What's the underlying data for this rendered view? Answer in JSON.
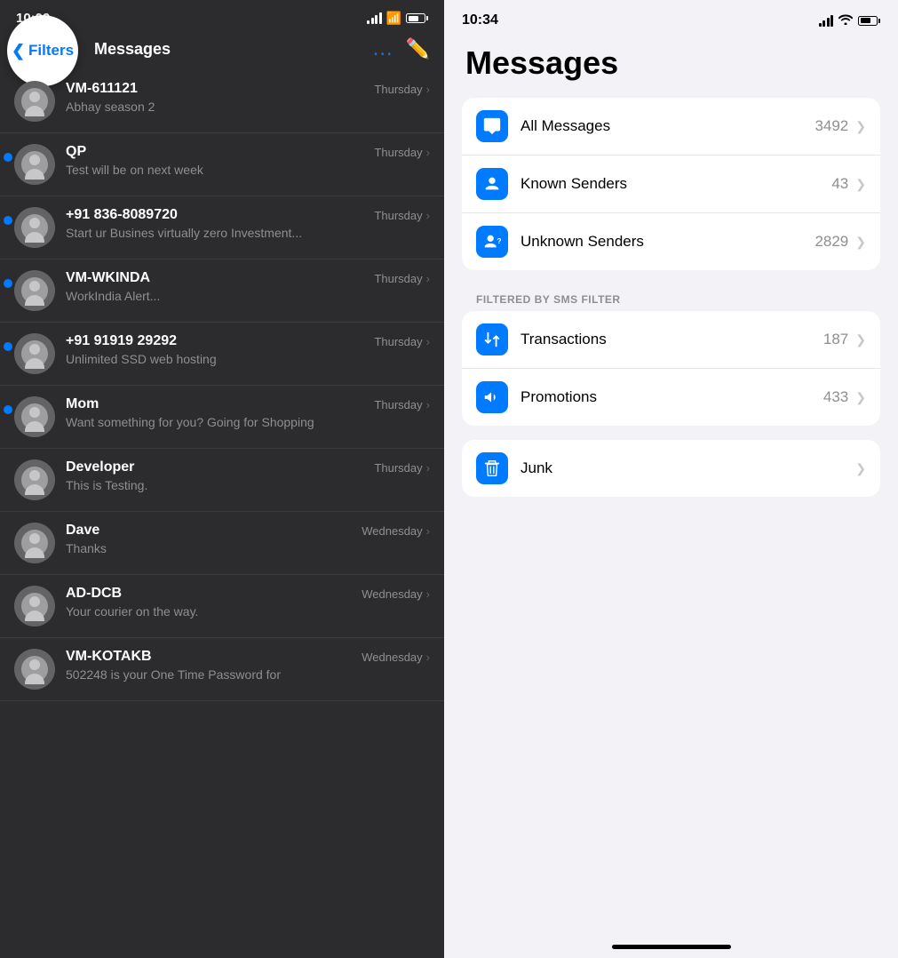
{
  "left": {
    "status_time": "10:09",
    "nav_title": "Messages",
    "filters_btn": "Filters",
    "messages": [
      {
        "id": "vm-611121",
        "name": "VM-611121",
        "date": "Thursday",
        "preview": "Abhay season 2",
        "unread": false
      },
      {
        "id": "qp",
        "name": "QP",
        "date": "Thursday",
        "preview": "Test will be on next week",
        "unread": true
      },
      {
        "id": "phone1",
        "name": "+91 836-8089720",
        "date": "Thursday",
        "preview": "Start ur Busines virtually zero Investment...",
        "unread": true
      },
      {
        "id": "vm-wkinda",
        "name": "VM-WKINDA",
        "date": "Thursday",
        "preview": "WorkIndia Alert...",
        "unread": true
      },
      {
        "id": "phone2",
        "name": "+91 91919 29292",
        "date": "Thursday",
        "preview": "Unlimited SSD web hosting",
        "unread": true
      },
      {
        "id": "mom",
        "name": "Mom",
        "date": "Thursday",
        "preview": "Want something for you? Going for Shopping",
        "unread": true
      },
      {
        "id": "developer",
        "name": "Developer",
        "date": "Thursday",
        "preview": "This is Testing.",
        "unread": false
      },
      {
        "id": "dave",
        "name": "Dave",
        "date": "Wednesday",
        "preview": "Thanks",
        "unread": false
      },
      {
        "id": "ad-dcb",
        "name": "AD-DCB",
        "date": "Wednesday",
        "preview": "Your courier on the way.",
        "unread": false
      },
      {
        "id": "vm-kotakb",
        "name": "VM-KOTAKB",
        "date": "Wednesday",
        "preview": "502248 is your One Time Password for",
        "unread": false
      }
    ]
  },
  "right": {
    "status_time": "10:34",
    "title": "Messages",
    "sections": [
      {
        "id": "main",
        "items": [
          {
            "id": "all-messages",
            "label": "All Messages",
            "count": "3492",
            "icon": "chat-bubble-icon"
          },
          {
            "id": "known-senders",
            "label": "Known Senders",
            "count": "43",
            "icon": "person-circle-icon"
          },
          {
            "id": "unknown-senders",
            "label": "Unknown Senders",
            "count": "2829",
            "icon": "person-question-icon"
          }
        ]
      }
    ],
    "filtered_label": "FILTERED BY",
    "filter_name": "SMS FILTER",
    "filtered_section": {
      "items": [
        {
          "id": "transactions",
          "label": "Transactions",
          "count": "187",
          "icon": "arrows-icon"
        },
        {
          "id": "promotions",
          "label": "Promotions",
          "count": "433",
          "icon": "megaphone-icon"
        }
      ]
    },
    "junk_section": {
      "items": [
        {
          "id": "junk",
          "label": "Junk",
          "count": "",
          "icon": "trash-icon"
        }
      ]
    }
  }
}
